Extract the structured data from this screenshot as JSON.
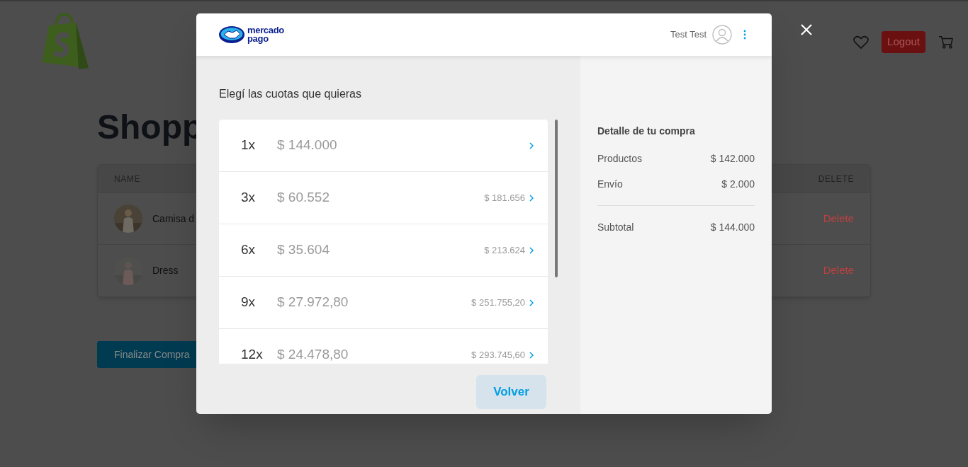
{
  "store": {
    "logout_button": "Logout",
    "heading": "Shopp",
    "table": {
      "columns": [
        "NAME",
        "DELETE"
      ],
      "rows": [
        {
          "name": "Camisa d",
          "action": "Delete"
        },
        {
          "name": "Dress",
          "action": "Delete"
        }
      ]
    },
    "checkout_button": "Finalizar Compra"
  },
  "modal": {
    "logo": [
      "mercado",
      "pago"
    ],
    "user": "Test Test",
    "title": "Elegí las cuotas que quieras",
    "installments": [
      {
        "count": "1x",
        "amount": "$ 144.000"
      },
      {
        "count": "3x",
        "amount": "$ 60.552",
        "total": "$ 181.656"
      },
      {
        "count": "6x",
        "amount": "$ 35.604",
        "total": "$ 213.624"
      },
      {
        "count": "9x",
        "amount": "$ 27.972,80",
        "total": "$ 251.755,20"
      },
      {
        "count": "12x",
        "amount": "$ 24.478,80",
        "total": "$ 293.745,60"
      }
    ],
    "back_button": "Volver",
    "summary": {
      "title": "Detalle de tu compra",
      "lines": [
        {
          "label": "Productos",
          "value": "$ 142.000"
        },
        {
          "label": "Envío",
          "value": "$ 2.000"
        }
      ],
      "subtotal": {
        "label": "Subtotal",
        "value": "$ 144.000"
      }
    }
  }
}
